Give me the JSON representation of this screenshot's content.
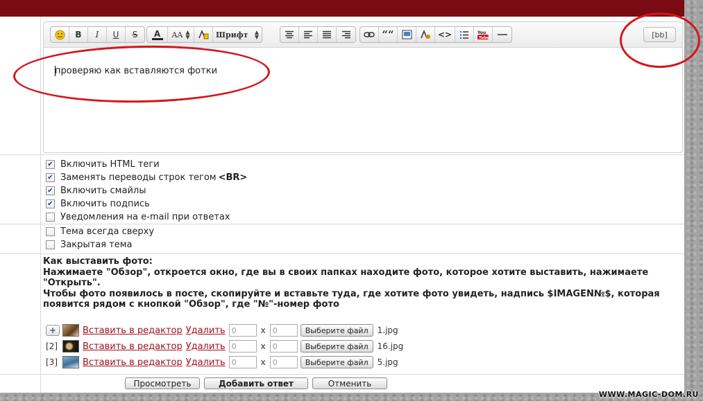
{
  "toolbar": {
    "font_label": "Шрифт",
    "bb_label": "[bb]",
    "bold": "B",
    "italic": "I",
    "underline": "U",
    "strike": "S",
    "color": "A",
    "size": "AA",
    "quote": "““",
    "code": "<>",
    "youtube": "You"
  },
  "editor": {
    "text": "проверяю как вставляются фотки"
  },
  "options_group1": [
    {
      "label": "Включить HTML теги",
      "checked": true
    },
    {
      "label": "Заменять переводы строк тегом ",
      "strong": "<BR>",
      "checked": true
    },
    {
      "label": "Включить смайлы",
      "checked": true
    },
    {
      "label": "Включить подпись",
      "checked": true
    },
    {
      "label": "Уведомления на e-mail при ответах",
      "checked": false
    }
  ],
  "options_group2": [
    {
      "label": "Тема всегда сверху",
      "checked": false
    },
    {
      "label": "Закрытая тема",
      "checked": false
    }
  ],
  "instructions": {
    "line1": "Как выставить фото:",
    "line2": "Нажимаете \"Обзор\", откроется окно, где вы в своих папках находите фото, которое хотите выставить, нажимаете",
    "line3": "\"Открыть\".",
    "line4": "Чтобы фото появилось в посте, скопируйте и вставьте туда, где хотите фото увидеть, надпись $IMAGEN№$, которая",
    "line5": "появится рядом с кнопкой \"Обзор\", где \"№\"-номер фото"
  },
  "attachments": {
    "plus_label": "+",
    "insert_label": "Вставить в редактор",
    "delete_label": "Удалить",
    "x_label": "x",
    "choose_label": "Выберите файл",
    "rows": [
      {
        "index": "",
        "width": "0",
        "height": "0",
        "file": "1.jpg"
      },
      {
        "index": "[2]",
        "width": "0",
        "height": "0",
        "file": "16.jpg"
      },
      {
        "index": "[3]",
        "width": "0",
        "height": "0",
        "file": "5.jpg"
      }
    ]
  },
  "buttons": {
    "preview": "Просмотреть",
    "submit": "Добавить ответ",
    "cancel": "Отменить"
  },
  "watermark": "WWW.MAGIC-DOM.RU",
  "colors": {
    "topbar": "#7a0b12",
    "link": "#a0121c",
    "annotation": "#d4161d"
  }
}
